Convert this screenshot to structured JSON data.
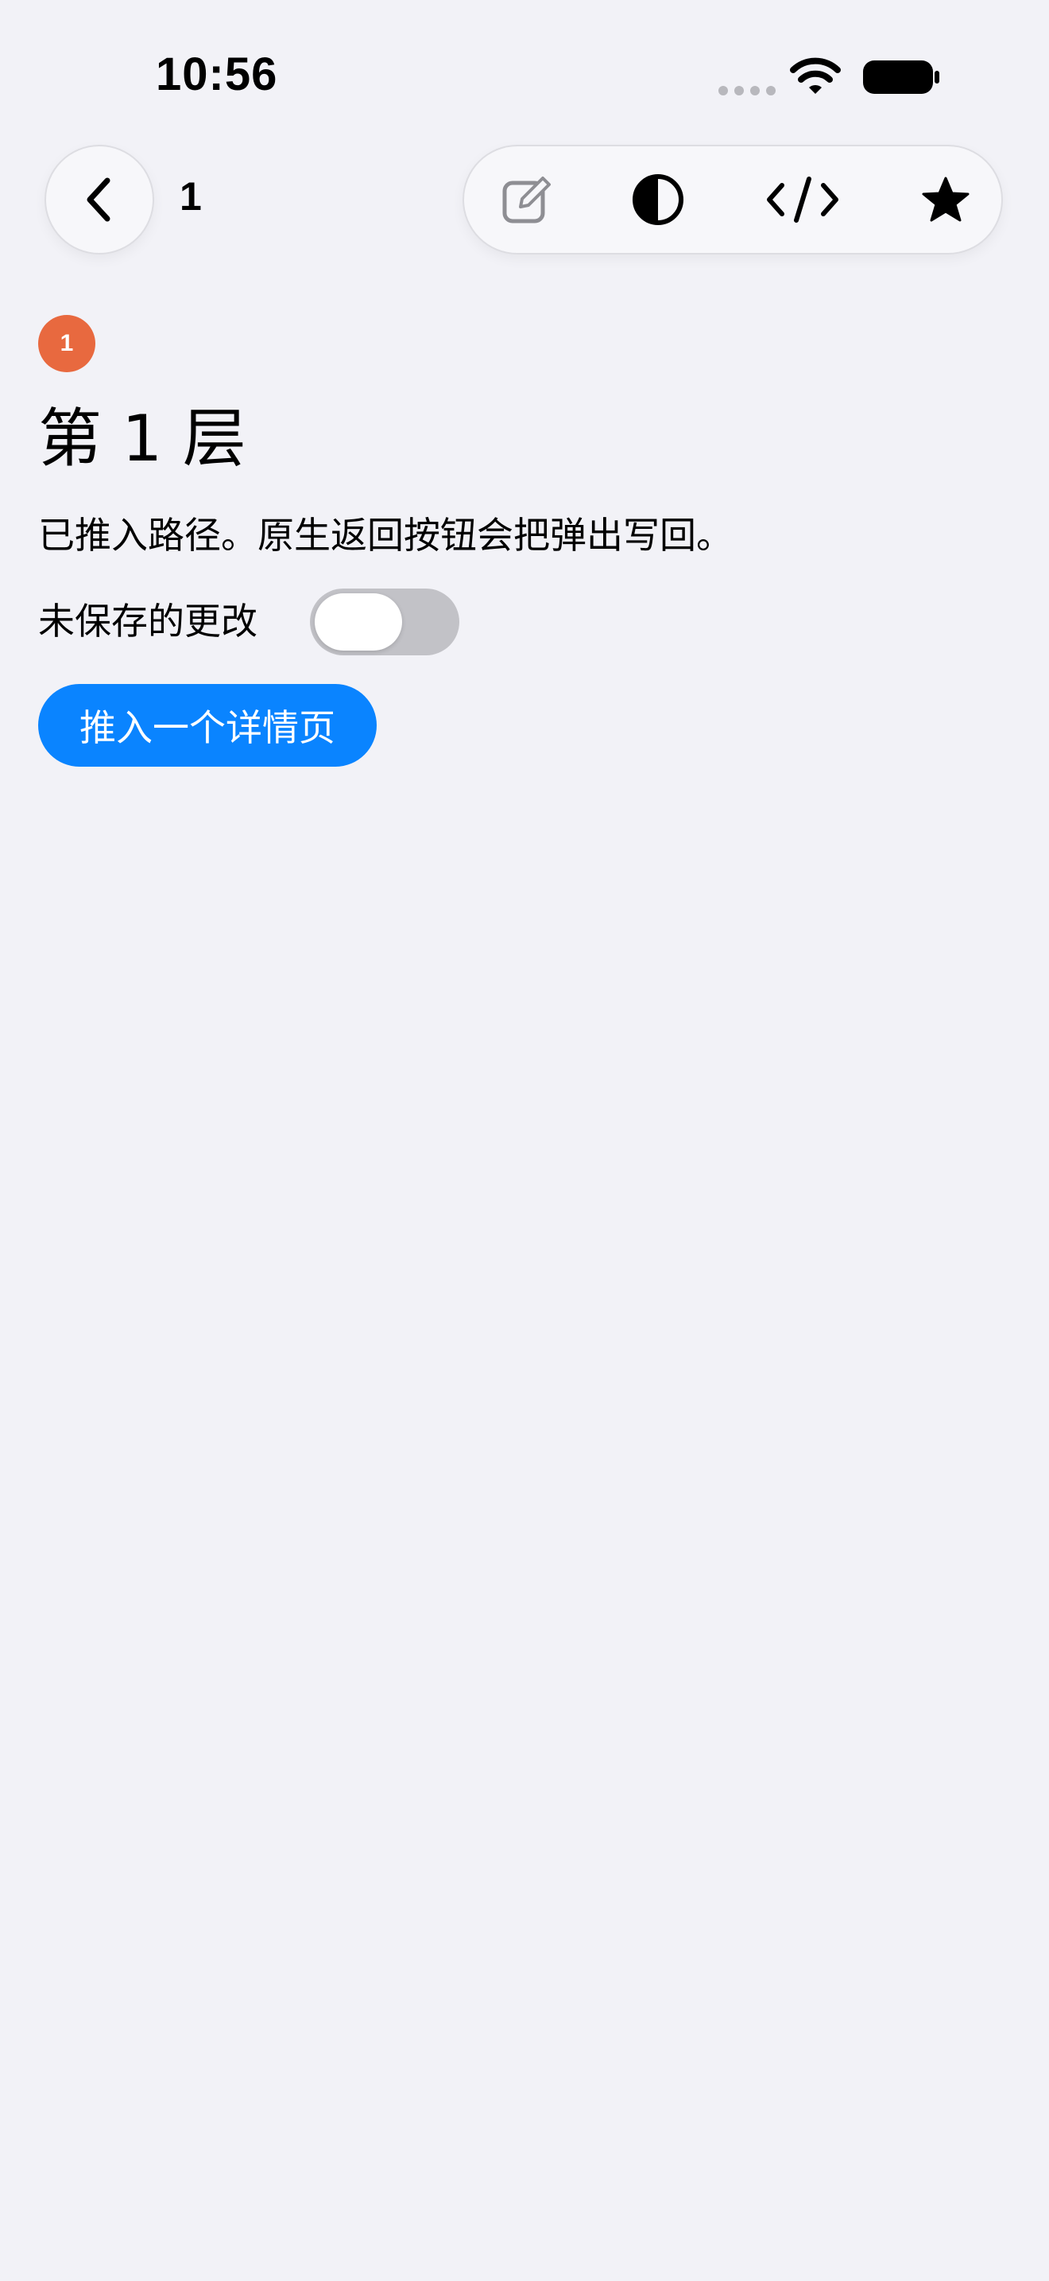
{
  "status_bar": {
    "time": "10:56",
    "signal_icon": "signal-dots-icon",
    "wifi_icon": "wifi-icon",
    "battery_icon": "battery-icon"
  },
  "nav": {
    "back_icon": "chevron-left-icon",
    "title": "1",
    "toolbar_icons": [
      "compose-icon",
      "contrast-icon",
      "code-icon",
      "star-icon"
    ]
  },
  "content": {
    "badge": "1",
    "title": "第 1 层",
    "subtitle": "已推入路径。原生返回按钮会把弹出写回。",
    "toggle_label": "未保存的更改",
    "toggle_on": false,
    "push_button_label": "推入一个详情页"
  },
  "colors": {
    "background": "#f2f2f7",
    "badge": "#e8693f",
    "accent": "#0a84ff",
    "toggle_off": "#c2c2c7"
  }
}
